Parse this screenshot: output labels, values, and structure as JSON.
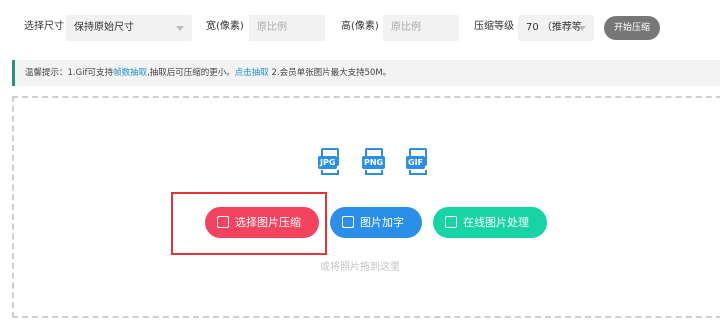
{
  "toolbar": {
    "size_label": "选择尺寸",
    "size_select_value": "保持原始尺寸",
    "width_label": "宽(像素)",
    "width_placeholder": "原比例",
    "height_label": "高(像素)",
    "height_placeholder": "原比例",
    "level_label": "压缩等级",
    "level_select_value": "70 （推荐等",
    "start_button": "开始压缩"
  },
  "tip": {
    "prefix": "温馨提示：1.Gif可支持",
    "link1": "帧数抽取",
    "middle": ",抽取后可压缩的更小。",
    "link2": "点击抽取",
    "suffix": " 2.会员单张图片最大支持50M。"
  },
  "dropzone": {
    "file_types": [
      "JPG",
      "PNG",
      "GIF"
    ],
    "buttons": {
      "select": "选择图片压缩",
      "text": "图片加字",
      "online": "在线图片处理"
    },
    "drag_hint": "或将照片拖到这里"
  },
  "colors": {
    "accent_tip": "#2a8f7e",
    "link": "#1e8fd6",
    "btn_select": "#f4435e",
    "btn_text": "#2b8ee8",
    "btn_online": "#17d4a4",
    "highlight": "#e03636"
  }
}
